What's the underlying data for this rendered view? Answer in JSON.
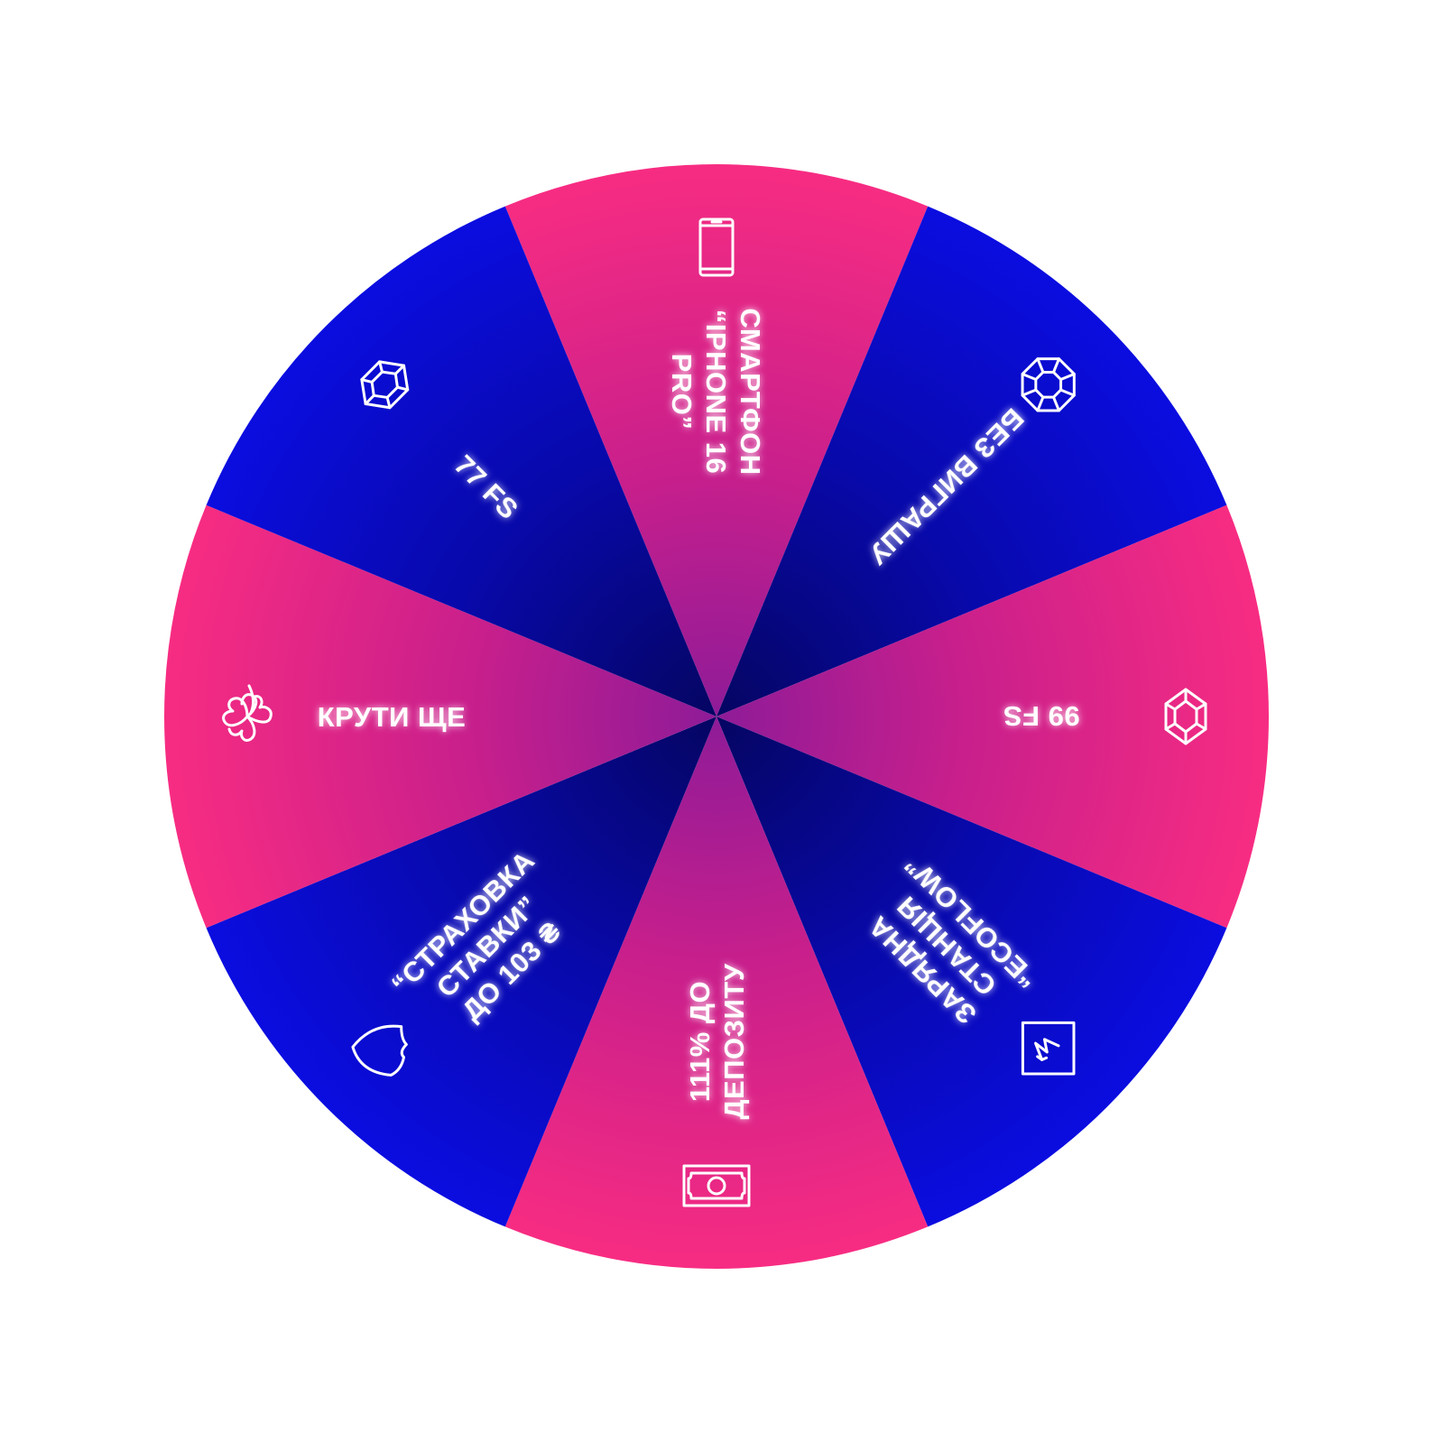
{
  "wheel": {
    "colors": {
      "pink": "#f72c82",
      "blue": "#0a0bd9",
      "pink_center": "#9b1d97",
      "blue_center": "#070878"
    },
    "segments": [
      {
        "color": "pink",
        "icon": "phone-icon",
        "lines": [
          "СМАРТФОН",
          "“IPHONE 16",
          "PRO”"
        ]
      },
      {
        "color": "blue",
        "icon": "round-gem-icon",
        "lines": [
          "БЕЗ ВИГРАШУ"
        ]
      },
      {
        "color": "pink",
        "icon": "gem-icon",
        "lines": [
          "99 FS"
        ]
      },
      {
        "color": "blue",
        "icon": "lightning-card-icon",
        "lines": [
          "ЗАРЯДНА",
          "СТАНЦІЯ",
          "“ECOFLOW”"
        ]
      },
      {
        "color": "pink",
        "icon": "money-icon",
        "lines": [
          "111% ДО",
          "ДЕПОЗИТУ"
        ]
      },
      {
        "color": "blue",
        "icon": "shield-icon",
        "lines": [
          "“СТРАХОВКА",
          "СТАВКИ”",
          "ДО 103 ₴"
        ]
      },
      {
        "color": "pink",
        "icon": "clover-icon",
        "lines": [
          "КРУТИ ЩЕ"
        ]
      },
      {
        "color": "blue",
        "icon": "gem-icon",
        "lines": [
          "77 FS"
        ]
      }
    ]
  }
}
